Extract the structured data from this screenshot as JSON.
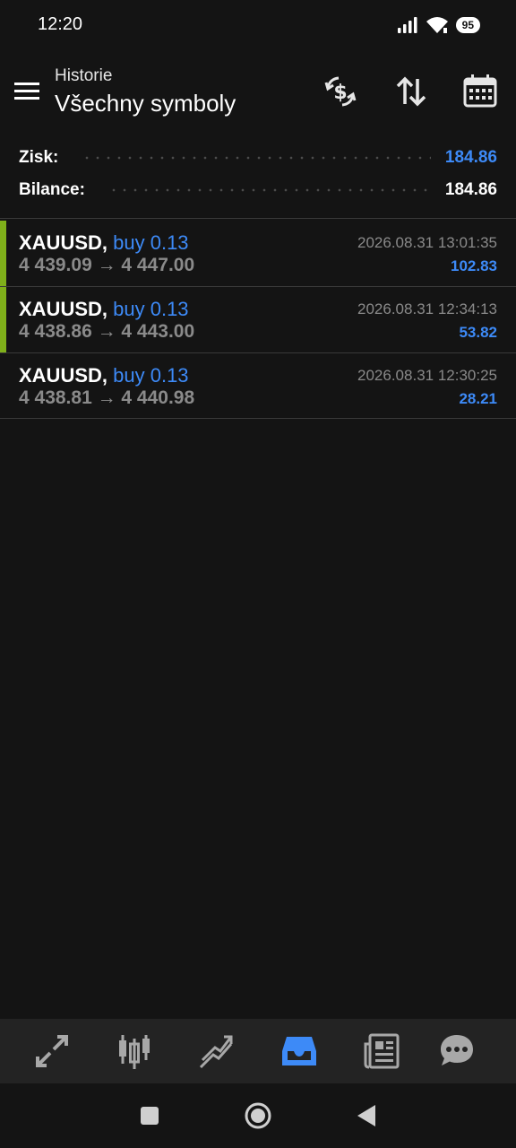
{
  "status_bar": {
    "time": "12:20",
    "battery": "95",
    "icons": [
      "signal-icon",
      "wifi-icon",
      "battery-icon"
    ]
  },
  "header": {
    "subtitle": "Historie",
    "title": "Všechny symboly",
    "actions": [
      "currency-exchange-icon",
      "sort-icon",
      "calendar-icon"
    ]
  },
  "summary": {
    "profit_label": "Zisk:",
    "profit_value": "184.86",
    "balance_label": "Bilance:",
    "balance_value": "184.86"
  },
  "deals": [
    {
      "symbol": "XAUUSD,",
      "type": "buy 0.13",
      "prices": "4 439.09 → 4 447.00",
      "time": "2026.08.31 13:01:35",
      "profit": "102.83"
    },
    {
      "symbol": "XAUUSD,",
      "type": "buy 0.13",
      "prices": "4 438.86 → 4 443.00",
      "time": "2026.08.31 12:34:13",
      "profit": "53.82"
    },
    {
      "symbol": "XAUUSD,",
      "type": "buy 0.13",
      "prices": "4 438.81 → 4 440.98",
      "time": "2026.08.31 12:30:25",
      "profit": "28.21"
    }
  ],
  "tabs": [
    "quotes-icon",
    "chart-icon",
    "trade-icon",
    "history-icon",
    "news-icon",
    "chat-icon"
  ],
  "active_tab": "history-icon",
  "colors": {
    "background": "#141414",
    "accent": "#3d8af7",
    "buy_bar": "#7fb01a",
    "muted_text": "#8a8a8a",
    "tab_bar": "#232323"
  }
}
